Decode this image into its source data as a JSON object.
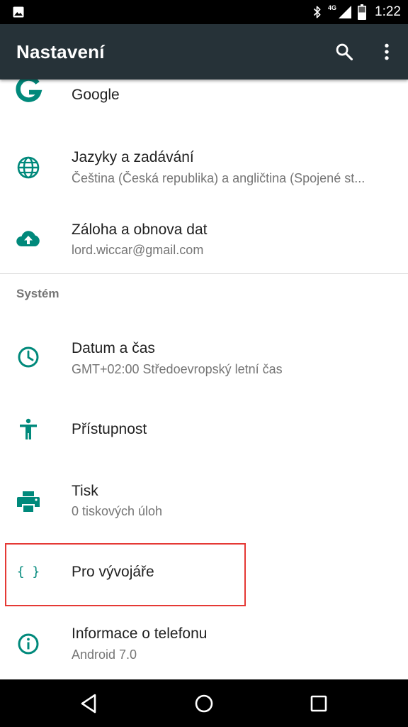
{
  "status_bar": {
    "time": "1:22",
    "network": "4G",
    "icons": [
      "image-icon",
      "bluetooth-icon",
      "signal-icon",
      "battery-icon"
    ]
  },
  "app_bar": {
    "title": "Nastavení",
    "icons": [
      "search-icon",
      "more-vert-icon"
    ],
    "background": "#263238"
  },
  "accent_color": "#00897B",
  "settings": {
    "items": [
      {
        "title": "Google",
        "subtitle": "",
        "icon": "google-icon"
      },
      {
        "title": "Jazyky a zadávání",
        "subtitle": "Čeština (Česká republika) a angličtina (Spojené st...",
        "icon": "globe-icon"
      },
      {
        "title": "Záloha a obnova dat",
        "subtitle": "lord.wiccar@gmail.com",
        "icon": "cloud-upload-icon"
      }
    ],
    "section_header": "Systém",
    "system_items": [
      {
        "title": "Datum a čas",
        "subtitle": "GMT+02:00 Středoevropský letní čas",
        "icon": "clock-icon"
      },
      {
        "title": "Přístupnost",
        "subtitle": "",
        "icon": "accessibility-icon"
      },
      {
        "title": "Tisk",
        "subtitle": "0 tiskových úloh",
        "icon": "printer-icon"
      },
      {
        "title": "Pro vývojáře",
        "subtitle": "",
        "icon": "developer-braces-icon",
        "highlighted": true,
        "highlight_color": "#E53935"
      },
      {
        "title": "Informace o telefonu",
        "subtitle": "Android 7.0",
        "icon": "info-icon"
      }
    ]
  },
  "nav_bar": {
    "icons": [
      "back-icon",
      "home-icon",
      "recents-icon"
    ]
  }
}
